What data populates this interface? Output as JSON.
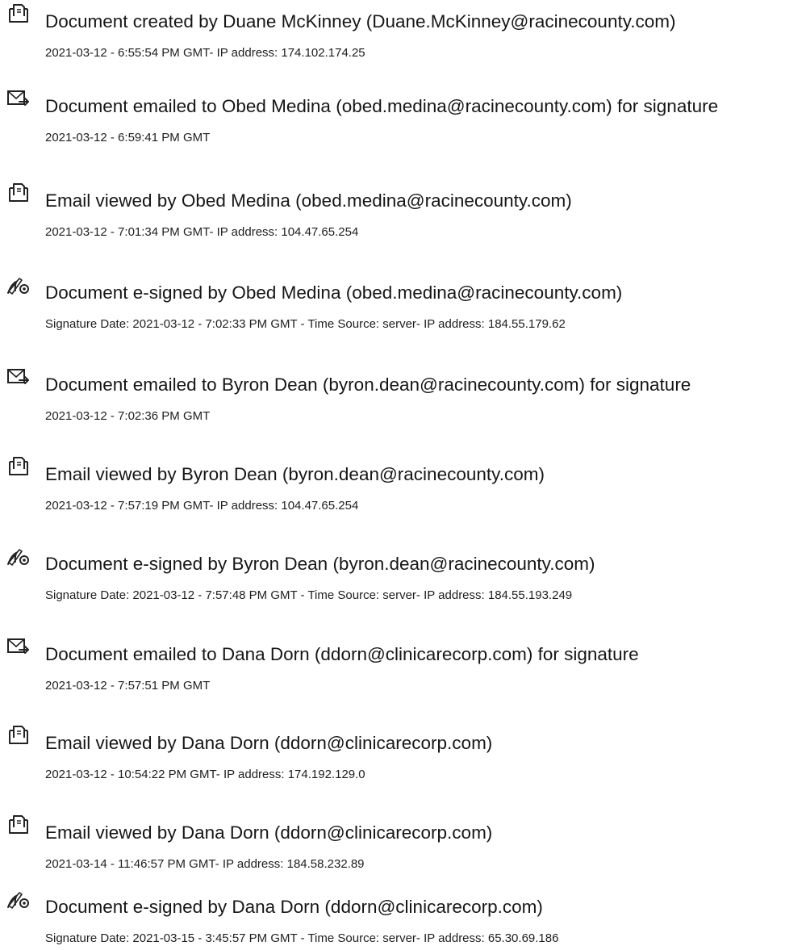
{
  "events": [
    {
      "icon": "document-created-icon",
      "title": "Document created by Duane McKinney (Duane.McKinney@racinecounty.com)",
      "detail": "2021-03-12 - 6:55:54 PM GMT- IP address: 174.102.174.25"
    },
    {
      "icon": "email-sent-icon",
      "title": "Document emailed to Obed Medina (obed.medina@racinecounty.com) for signature",
      "detail": "2021-03-12 - 6:59:41 PM GMT"
    },
    {
      "icon": "email-viewed-icon",
      "title": "Email viewed by Obed Medina (obed.medina@racinecounty.com)",
      "detail": "2021-03-12 - 7:01:34 PM GMT- IP address: 104.47.65.254"
    },
    {
      "icon": "e-signature-icon",
      "title": "Document e-signed by Obed Medina (obed.medina@racinecounty.com)",
      "detail": "Signature Date: 2021-03-12 - 7:02:33 PM GMT - Time Source: server- IP address: 184.55.179.62"
    },
    {
      "icon": "email-sent-icon",
      "title": "Document emailed to Byron Dean (byron.dean@racinecounty.com) for signature",
      "detail": "2021-03-12 - 7:02:36 PM GMT"
    },
    {
      "icon": "email-viewed-icon",
      "title": "Email viewed by Byron Dean (byron.dean@racinecounty.com)",
      "detail": "2021-03-12 - 7:57:19 PM GMT- IP address: 104.47.65.254"
    },
    {
      "icon": "e-signature-icon",
      "title": "Document e-signed by Byron Dean (byron.dean@racinecounty.com)",
      "detail": "Signature Date: 2021-03-12 - 7:57:48 PM GMT - Time Source: server- IP address: 184.55.193.249"
    },
    {
      "icon": "email-sent-icon",
      "title": "Document emailed to Dana Dorn (ddorn@clinicarecorp.com) for signature",
      "detail": "2021-03-12 - 7:57:51 PM GMT"
    },
    {
      "icon": "email-viewed-icon",
      "title": "Email viewed by Dana Dorn (ddorn@clinicarecorp.com)",
      "detail": "2021-03-12 - 10:54:22 PM GMT- IP address: 174.192.129.0"
    },
    {
      "icon": "email-viewed-icon",
      "title": "Email viewed by Dana Dorn (ddorn@clinicarecorp.com)",
      "detail": "2021-03-14 - 11:46:57 PM GMT- IP address: 184.58.232.89"
    },
    {
      "icon": "e-signature-icon",
      "title": "Document e-signed by Dana Dorn (ddorn@clinicarecorp.com)",
      "detail": "Signature Date: 2021-03-15 - 3:45:57 PM GMT - Time Source: server- IP address: 65.30.69.186"
    }
  ]
}
